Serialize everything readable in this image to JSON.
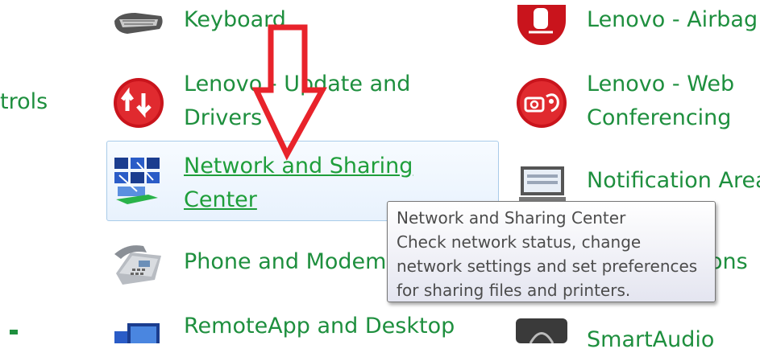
{
  "sidebar": {
    "partial_label": "trols"
  },
  "items": {
    "keyboard": "Keyboard",
    "lenovo_update_line1": "Lenovo - Update and",
    "lenovo_update_line2": "Drivers",
    "network_line1": "Network and Sharing",
    "network_line2": "Center",
    "phone_modem": "Phone and Modem",
    "remoteapp": "RemoteApp and Desktop",
    "lenovo_airbag": "Lenovo - Airbag",
    "lenovo_web_line1": "Lenovo - Web",
    "lenovo_web_line2": "Conferencing",
    "notification": "Notification Area",
    "ons_partial": "ons",
    "smartaudio": "SmartAudio"
  },
  "tooltip": {
    "title": "Network and Sharing Center",
    "line1": "Check network status, change",
    "line2": "network settings and set preferences",
    "line3": "for sharing files and printers."
  },
  "colors": {
    "link_green": "#1e8f3e",
    "arrow_red": "#e8232b",
    "hover_border": "#a9cbe9"
  }
}
